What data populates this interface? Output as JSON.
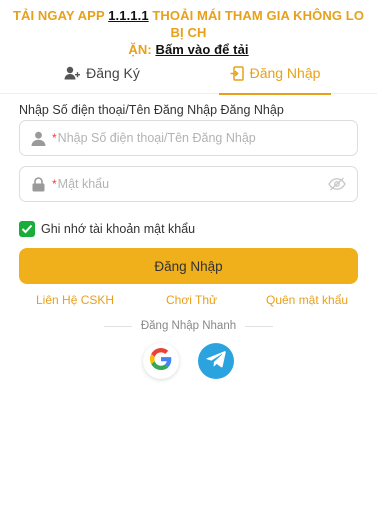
{
  "banner": {
    "prefix": "TẢI NGAY APP ",
    "app_version": "1.1.1.1",
    "middle": " THOẢI MÁI THAM GIA KHÔNG LO BỊ CH",
    "line2_prefix": "ẶN: ",
    "link_text": "Bấm vào để tải"
  },
  "tabs": {
    "register_label": "Đăng Ký",
    "login_label": "Đăng Nhập"
  },
  "form": {
    "account_label": "Nhập Số điện thoại/Tên Đăng Nhập Đăng Nhập",
    "account_placeholder": "Nhập Số điện thoại/Tên Đăng Nhập",
    "account_value": "",
    "password_placeholder": "Mật khẩu",
    "password_value": "",
    "required_mark": "*",
    "remember_label": "Ghi nhớ tài khoản mật khẩu",
    "remember_checked": true,
    "submit_label": "Đăng Nhập"
  },
  "links": {
    "support": "Liên Hệ CSKH",
    "trial": "Chơi Thử",
    "forgot": "Quên mật khẩu"
  },
  "quick_login": {
    "label": "Đăng Nhập Nhanh",
    "providers": [
      "google-icon",
      "telegram-icon"
    ]
  },
  "colors": {
    "accent": "#e8a01a",
    "button": "#efb01c",
    "checkbox": "#1aad3a",
    "telegram": "#2aa3de"
  }
}
